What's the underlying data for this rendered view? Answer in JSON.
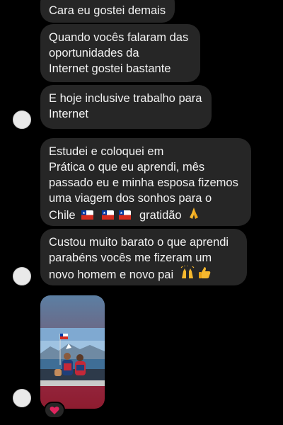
{
  "messages": [
    {
      "lines": [
        "Cara eu gostei demais"
      ]
    },
    {
      "lines": [
        "Quando vocês falaram das",
        "oportunidades da",
        "Internet gostei bastante"
      ]
    },
    {
      "lines": [
        "E hoje inclusive trabalho para",
        "Internet"
      ]
    },
    {
      "lines": [
        "Estudei e coloquei em",
        "Prática o que eu aprendi, mês",
        "passado eu e minha esposa fizemos",
        "uma viagem dos sonhos para o"
      ],
      "last_line_prefix": "Chile",
      "flag_icon": "chile-flag-icon",
      "last_line_suffix": "gratidão",
      "hands_icon": "folded-hands-icon"
    },
    {
      "lines": [
        "Custou muito barato  o que aprendi",
        "parabéns vocês me fizeram um"
      ],
      "last_line": "novo homem e novo pai",
      "icons": [
        "raising-hands-icon",
        "thumbs-up-icon"
      ]
    }
  ],
  "photo_message": {
    "icon": "photo-couple-boat-icon",
    "reaction": {
      "icon": "red-heart-icon",
      "color": "#e0245e"
    }
  },
  "colors": {
    "background": "#000000",
    "bubble": "#262626",
    "text": "#f2f2f2",
    "avatar": "#e9e9e9"
  }
}
